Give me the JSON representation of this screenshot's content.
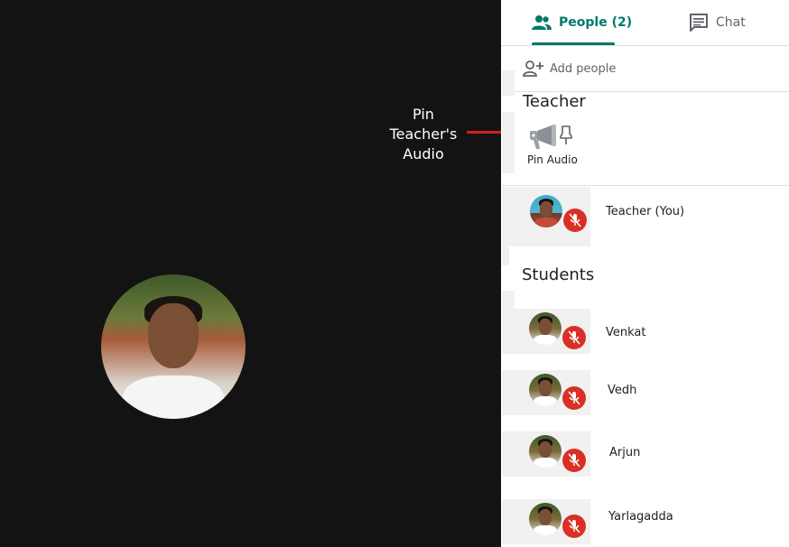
{
  "annotation": {
    "line1": "Pin",
    "line2": "Teacher's",
    "line3": "Audio",
    "line_color": "#d91b1b"
  },
  "main_video": {
    "avatar_icon": "participant-photo"
  },
  "tabs": {
    "people_label": "People (2)",
    "chat_label": "Chat",
    "active": "people",
    "accent": "#00796b"
  },
  "add_people": {
    "label": "Add people"
  },
  "teacher_section": {
    "title": "Teacher",
    "pin_audio_label": "Pin Audio",
    "participant": {
      "name": "Teacher (You)",
      "muted": true
    }
  },
  "students_section": {
    "title": "Students",
    "participants": [
      {
        "name": "Venkat",
        "muted": true
      },
      {
        "name": "Vedh",
        "muted": true
      },
      {
        "name": "Arjun",
        "muted": true
      },
      {
        "name": "Yarlagadda",
        "muted": true
      }
    ]
  },
  "colors": {
    "muted_badge": "#d93025",
    "background": "#131313"
  }
}
